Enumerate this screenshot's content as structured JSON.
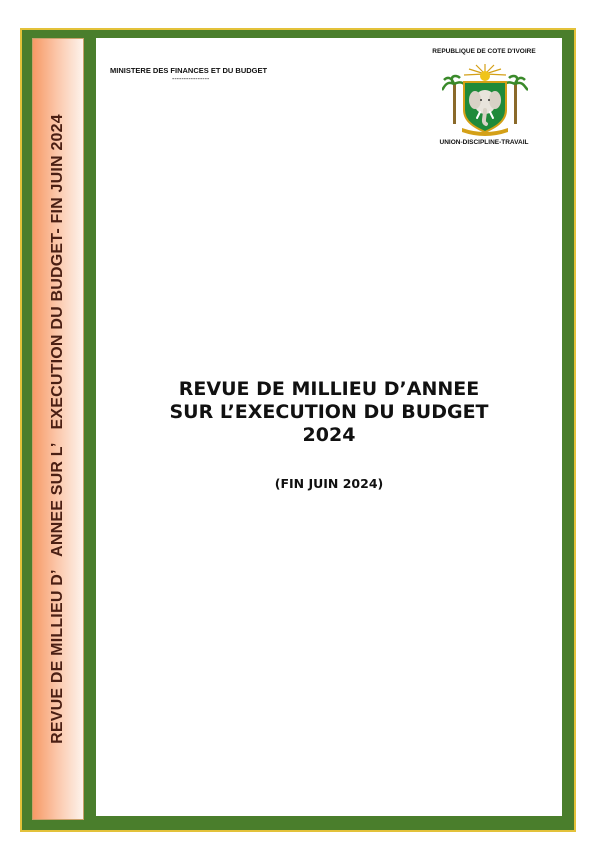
{
  "header": {
    "ministry": "MINISTERE DES FINANCES ET DU BUDGET",
    "ministry_separator": "----------------",
    "republic": "REPUBLIQUE DE COTE D'IVOIRE",
    "motto": "UNION-DISCIPLINE-TRAVAIL"
  },
  "spine": {
    "text": "REVUE DE MILLIEU D’   ANNEE SUR L’   EXECUTION DU BUDGET- FIN JUIN 2024"
  },
  "title": {
    "line1": "REVUE DE MILLIEU D’ANNEE",
    "line2": "SUR L’EXECUTION DU BUDGET",
    "line3": "2024"
  },
  "subtitle": "(FIN JUIN 2024)",
  "colors": {
    "frame_green": "#4a7e2c",
    "frame_gold": "#e3c23a",
    "spine_orange": "#f79a66",
    "flag_orange": "#f7941d",
    "flag_green": "#11a04a"
  },
  "icons": {
    "coat_of_arms": "cote-divoire-coat-of-arms-icon"
  }
}
